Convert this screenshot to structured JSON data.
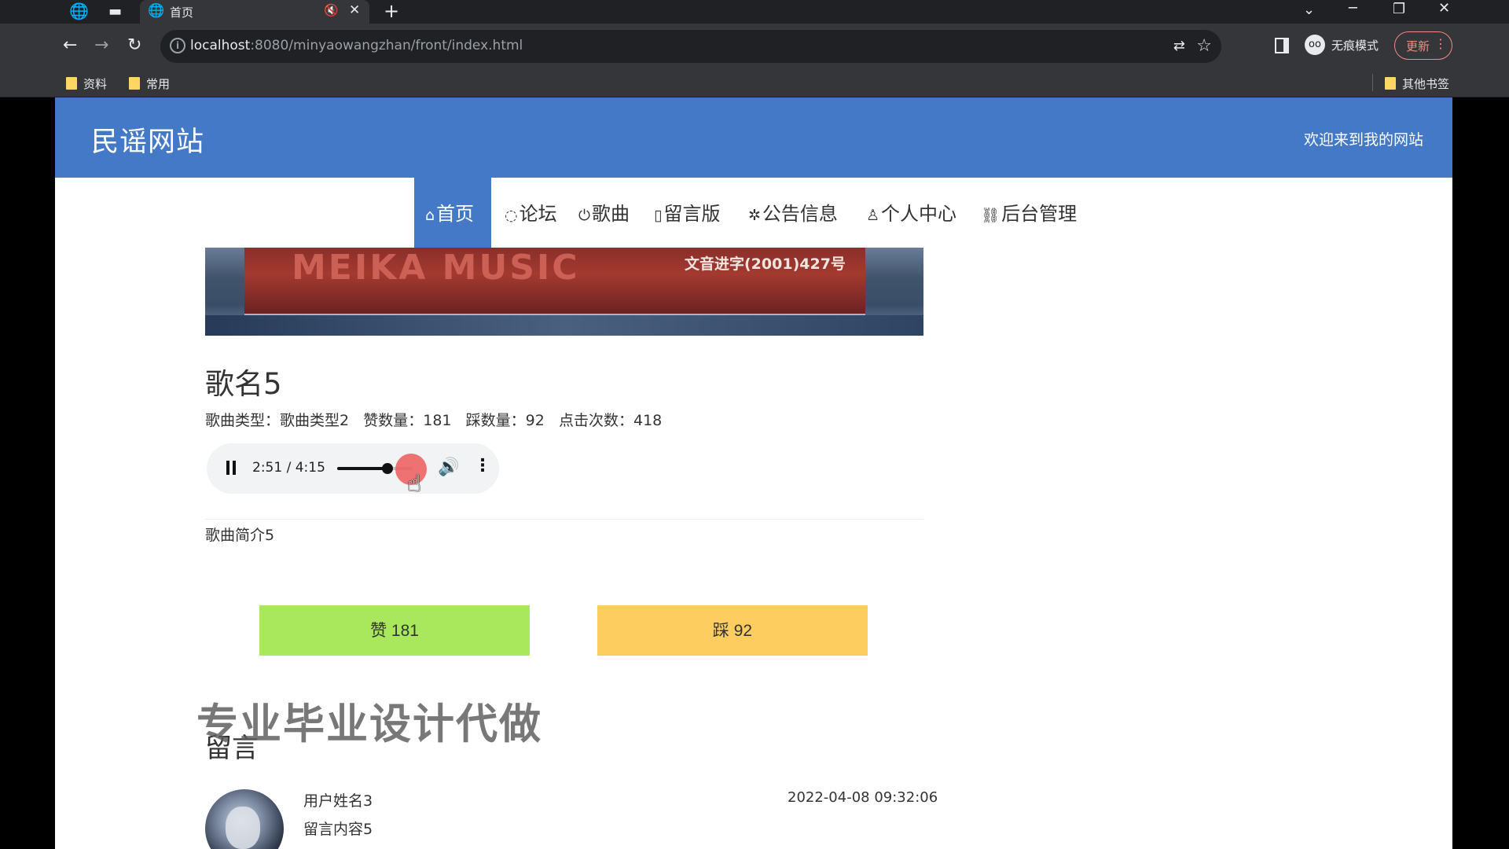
{
  "browser": {
    "tab_title": "首页",
    "url_host": "localhost",
    "url_rest": ":8080/minyaowangzhan/front/index.html",
    "incognito_label": "无痕模式",
    "update_label": "更新",
    "bookmarks": [
      "资料",
      "常用"
    ],
    "other_bookmarks": "其他书签"
  },
  "site": {
    "title": "民谣网站",
    "welcome": "欢迎来到我的网站"
  },
  "nav": [
    {
      "label": "首页",
      "icon": "home-icon",
      "active": true
    },
    {
      "label": "论坛",
      "icon": "chat-icon"
    },
    {
      "label": "歌曲",
      "icon": "power-icon"
    },
    {
      "label": "留言版",
      "icon": "note-icon"
    },
    {
      "label": "公告信息",
      "icon": "loading-icon"
    },
    {
      "label": "个人中心",
      "icon": "user-icon"
    },
    {
      "label": "后台管理",
      "icon": "link-icon"
    }
  ],
  "banner": {
    "brand_text": "MEIKA MUSIC",
    "license_text": "文音进字(2001)427号"
  },
  "song": {
    "title": "歌名5",
    "type_label": "歌曲类型：",
    "type_value": "歌曲类型2",
    "likes_label": "赞数量：",
    "likes_value": "181",
    "dislikes_label": "踩数量：",
    "dislikes_value": "92",
    "clicks_label": "点击次数：",
    "clicks_value": "418",
    "intro": "歌曲简介5"
  },
  "player": {
    "time_display": "2:51 / 4:15",
    "progress_fraction": 0.67
  },
  "actions": {
    "like_label": "赞   181",
    "dislike_label": "踩   92"
  },
  "watermark": "专业毕业设计代做",
  "comments": {
    "title": "留言",
    "items": [
      {
        "user": "用户姓名3",
        "date": "2022-04-08 09:32:06",
        "content": "留言内容5"
      }
    ]
  },
  "colors": {
    "header_blue": "#4479c8",
    "like_green": "#a9e85c",
    "dislike_yellow": "#fdcd5f"
  }
}
